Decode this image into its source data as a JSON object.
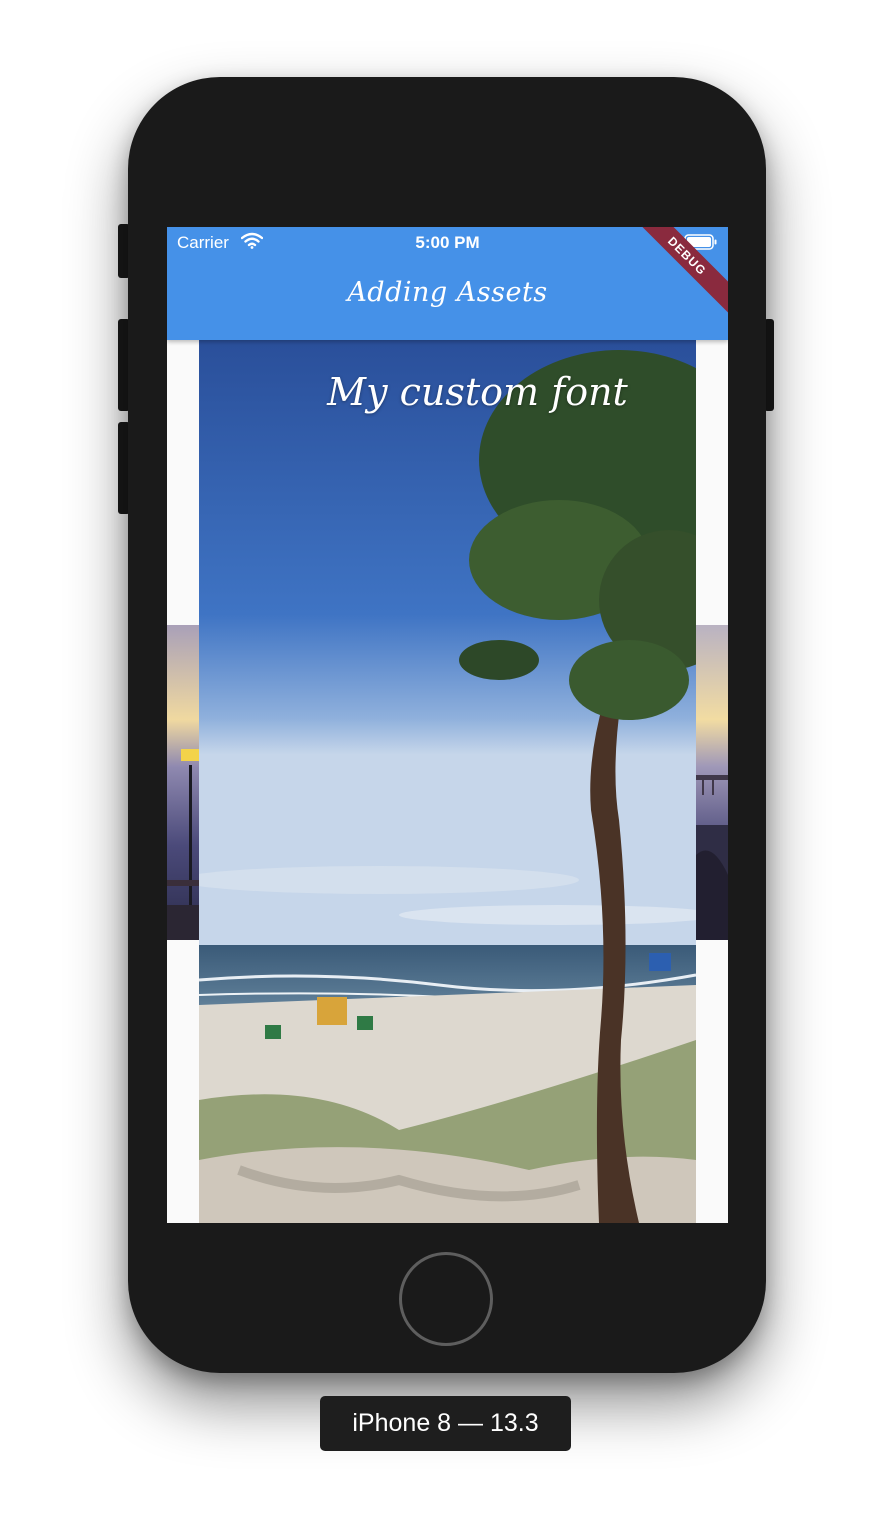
{
  "status_bar": {
    "carrier": "Carrier",
    "time": "5:00 PM"
  },
  "app_bar": {
    "title": "Adding Assets",
    "debug_label": "DEBUG"
  },
  "content": {
    "overlay_text": "My custom font"
  },
  "device_label": "iPhone 8 — 13.3",
  "colors": {
    "app_bar": "#4591e8",
    "debug_ribbon": "#8a2a3e",
    "phone_body": "#1a1a1a"
  }
}
